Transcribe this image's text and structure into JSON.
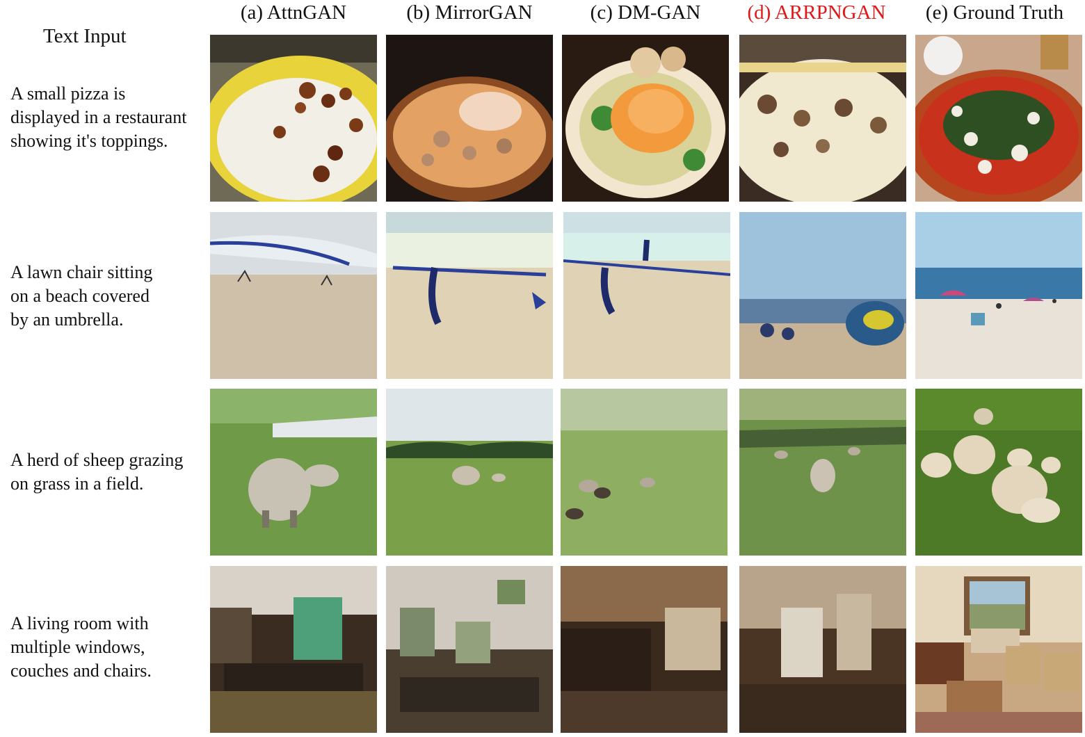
{
  "header": {
    "text_input": "Text Input",
    "columns": [
      {
        "label": "(a) AttnGAN",
        "color": "#111111"
      },
      {
        "label": "(b) MirrorGAN",
        "color": "#111111"
      },
      {
        "label": "(c) DM-GAN",
        "color": "#111111"
      },
      {
        "label": "(d) ARRPNGAN",
        "color": "#e01818"
      },
      {
        "label": "(e) Ground Truth",
        "color": "#111111"
      }
    ]
  },
  "rows": [
    {
      "caption": [
        "A small pizza is",
        "displayed in a restaurant",
        "showing it's toppings."
      ],
      "scene": "pizza"
    },
    {
      "caption": [
        "A lawn chair sitting",
        "on a beach covered",
        "by an umbrella."
      ],
      "scene": "beach"
    },
    {
      "caption": [
        "A herd of sheep grazing",
        "on grass in a field."
      ],
      "scene": "sheep"
    },
    {
      "caption": [
        "A living room with",
        "multiple windows,",
        "couches and chairs."
      ],
      "scene": "livingroom"
    }
  ]
}
